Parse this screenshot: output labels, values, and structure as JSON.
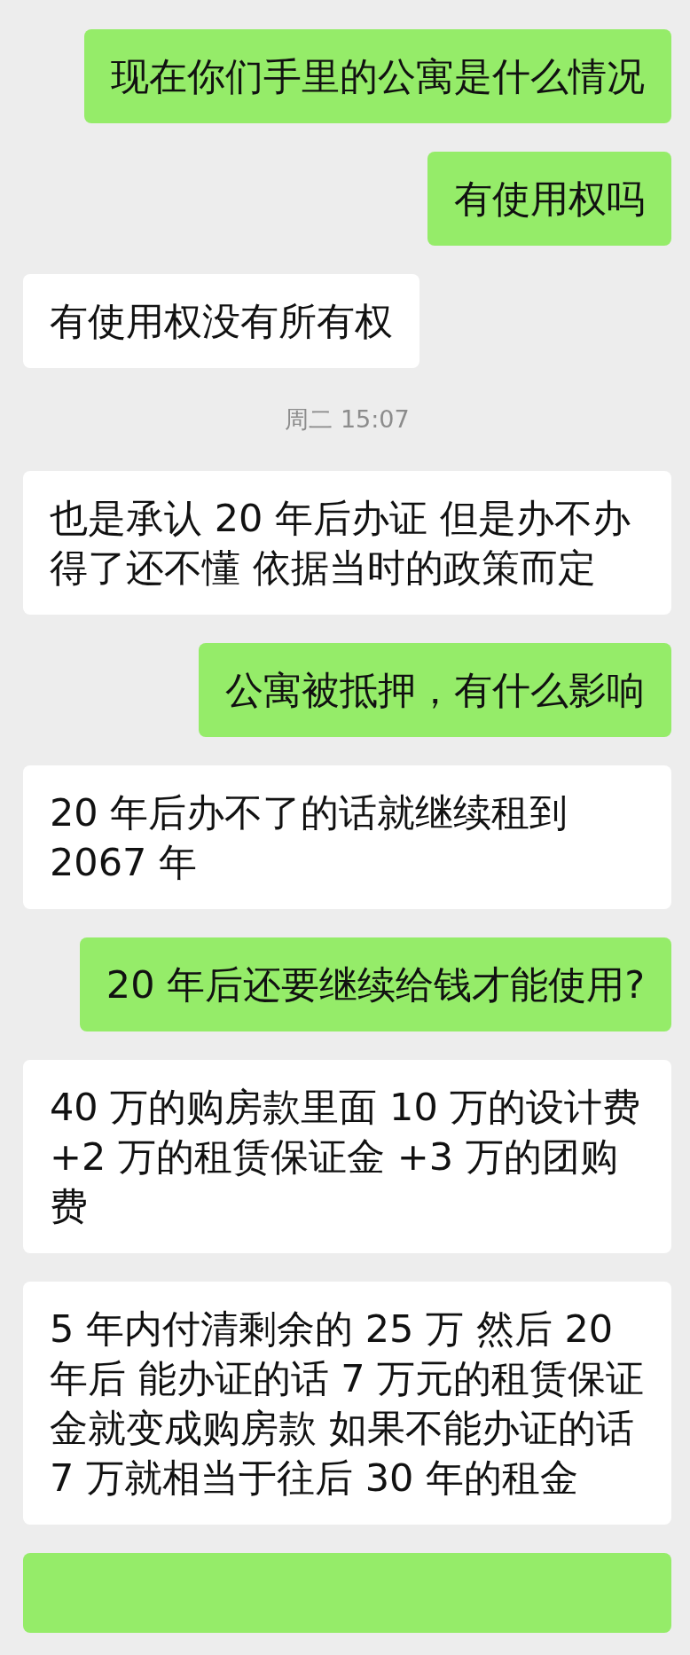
{
  "messages": [
    {
      "kind": "text",
      "sent": true,
      "text": "现在你们手里的公寓是什么情况"
    },
    {
      "kind": "text",
      "sent": true,
      "text": "有使用权吗"
    },
    {
      "kind": "text",
      "sent": false,
      "text": "有使用权没有所有权"
    },
    {
      "kind": "time",
      "text": "周二 15:07"
    },
    {
      "kind": "text",
      "sent": false,
      "text": "也是承认 20 年后办证 但是办不办得了还不懂 依据当时的政策而定"
    },
    {
      "kind": "text",
      "sent": true,
      "text": "公寓被抵押，有什么影响"
    },
    {
      "kind": "text",
      "sent": false,
      "text": "20 年后办不了的话就继续租到 2067 年"
    },
    {
      "kind": "text",
      "sent": true,
      "text": "20 年后还要继续给钱才能使用?"
    },
    {
      "kind": "text",
      "sent": false,
      "text": "40 万的购房款里面 10 万的设计费 +2 万的租赁保证金 +3 万的团购费"
    },
    {
      "kind": "text",
      "sent": false,
      "text": "5 年内付清剩余的 25 万 然后 20 年后  能办证的话 7 万元的租赁保证金就变成购房款 如果不能办证的话 7 万就相当于往后 30 年的租金"
    },
    {
      "kind": "clipped",
      "sent": true
    }
  ]
}
